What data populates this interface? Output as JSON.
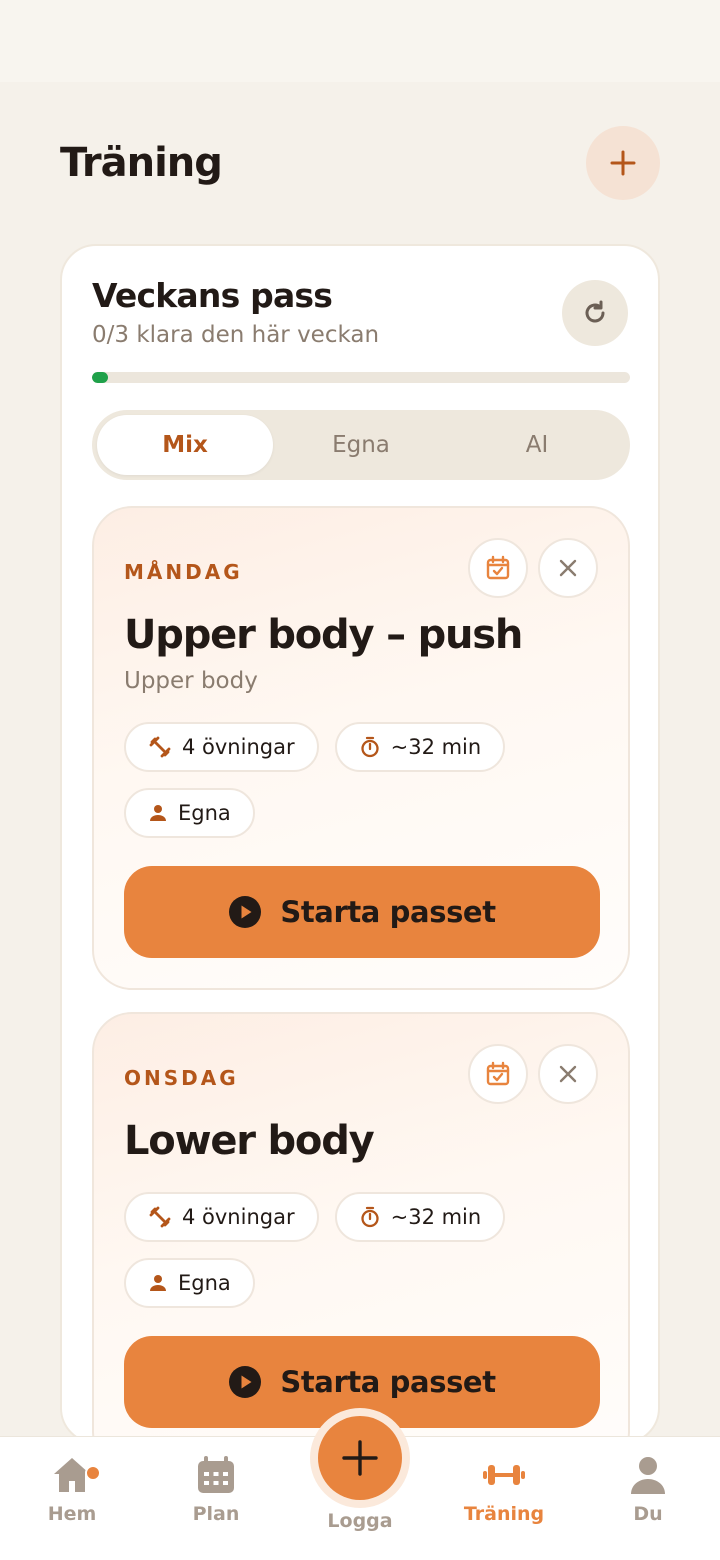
{
  "header": {
    "title": "Träning"
  },
  "weekly": {
    "title": "Veckans pass",
    "subtitle": "0/3 klara den här veckan",
    "progress_fraction": 0.0
  },
  "filter_tabs": [
    {
      "label": "Mix",
      "active": true
    },
    {
      "label": "Egna",
      "active": false
    },
    {
      "label": "AI",
      "active": false
    }
  ],
  "workouts": [
    {
      "day": "MÅNDAG",
      "title": "Upper body – push",
      "category": "Upper body",
      "exercises": "4 övningar",
      "duration": "~32 min",
      "source": "Egna",
      "start_label": "Starta passet"
    },
    {
      "day": "ONSDAG",
      "title": "Lower body",
      "exercises": "4 övningar",
      "duration": "~32 min",
      "source": "Egna",
      "start_label": "Starta passet"
    }
  ],
  "tabbar": {
    "home": "Hem",
    "plan": "Plan",
    "log": "Logga",
    "training": "Träning",
    "profile": "Du"
  },
  "colors": {
    "accent": "#e8843e",
    "accent_dark": "#b4561a",
    "success": "#1fa14a",
    "background": "#f5f1ea"
  }
}
